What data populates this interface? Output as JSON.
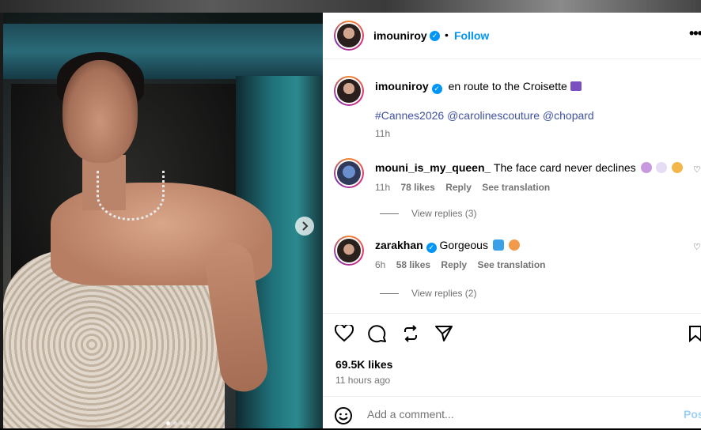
{
  "post": {
    "username": "imouniroy",
    "dot": "•",
    "follow_label": "Follow",
    "more_label": "•••",
    "caption_text": "en route to the Croisette",
    "hashtag": "#Cannes2026",
    "mention_1": "@carolinescouture",
    "mention_2": "@chopard",
    "caption_time": "11h"
  },
  "comments": [
    {
      "username": "mouni_is_my_queen_",
      "text": "The face card never declines",
      "time": "11h",
      "likes": "78 likes",
      "reply_label": "Reply",
      "translate_label": "See translation",
      "view_replies": "View replies (3)"
    },
    {
      "username": "zarakhan",
      "text": "Gorgeous",
      "time": "6h",
      "likes": "58 likes",
      "reply_label": "Reply",
      "translate_label": "See translation",
      "view_replies": "View replies (2)"
    }
  ],
  "footer": {
    "likes": "69.5K likes",
    "ago": "11 hours ago",
    "comment_placeholder": "Add a comment...",
    "post_label": "Post"
  },
  "icons": {
    "like": "heart-icon",
    "comment": "comment-icon",
    "repost": "repost-icon",
    "share": "share-icon",
    "save": "bookmark-icon",
    "emoji": "smiley-icon",
    "next": "chevron-right-icon"
  },
  "colors": {
    "accent": "#0095f6",
    "link": "#4152a3",
    "muted": "#737373"
  }
}
